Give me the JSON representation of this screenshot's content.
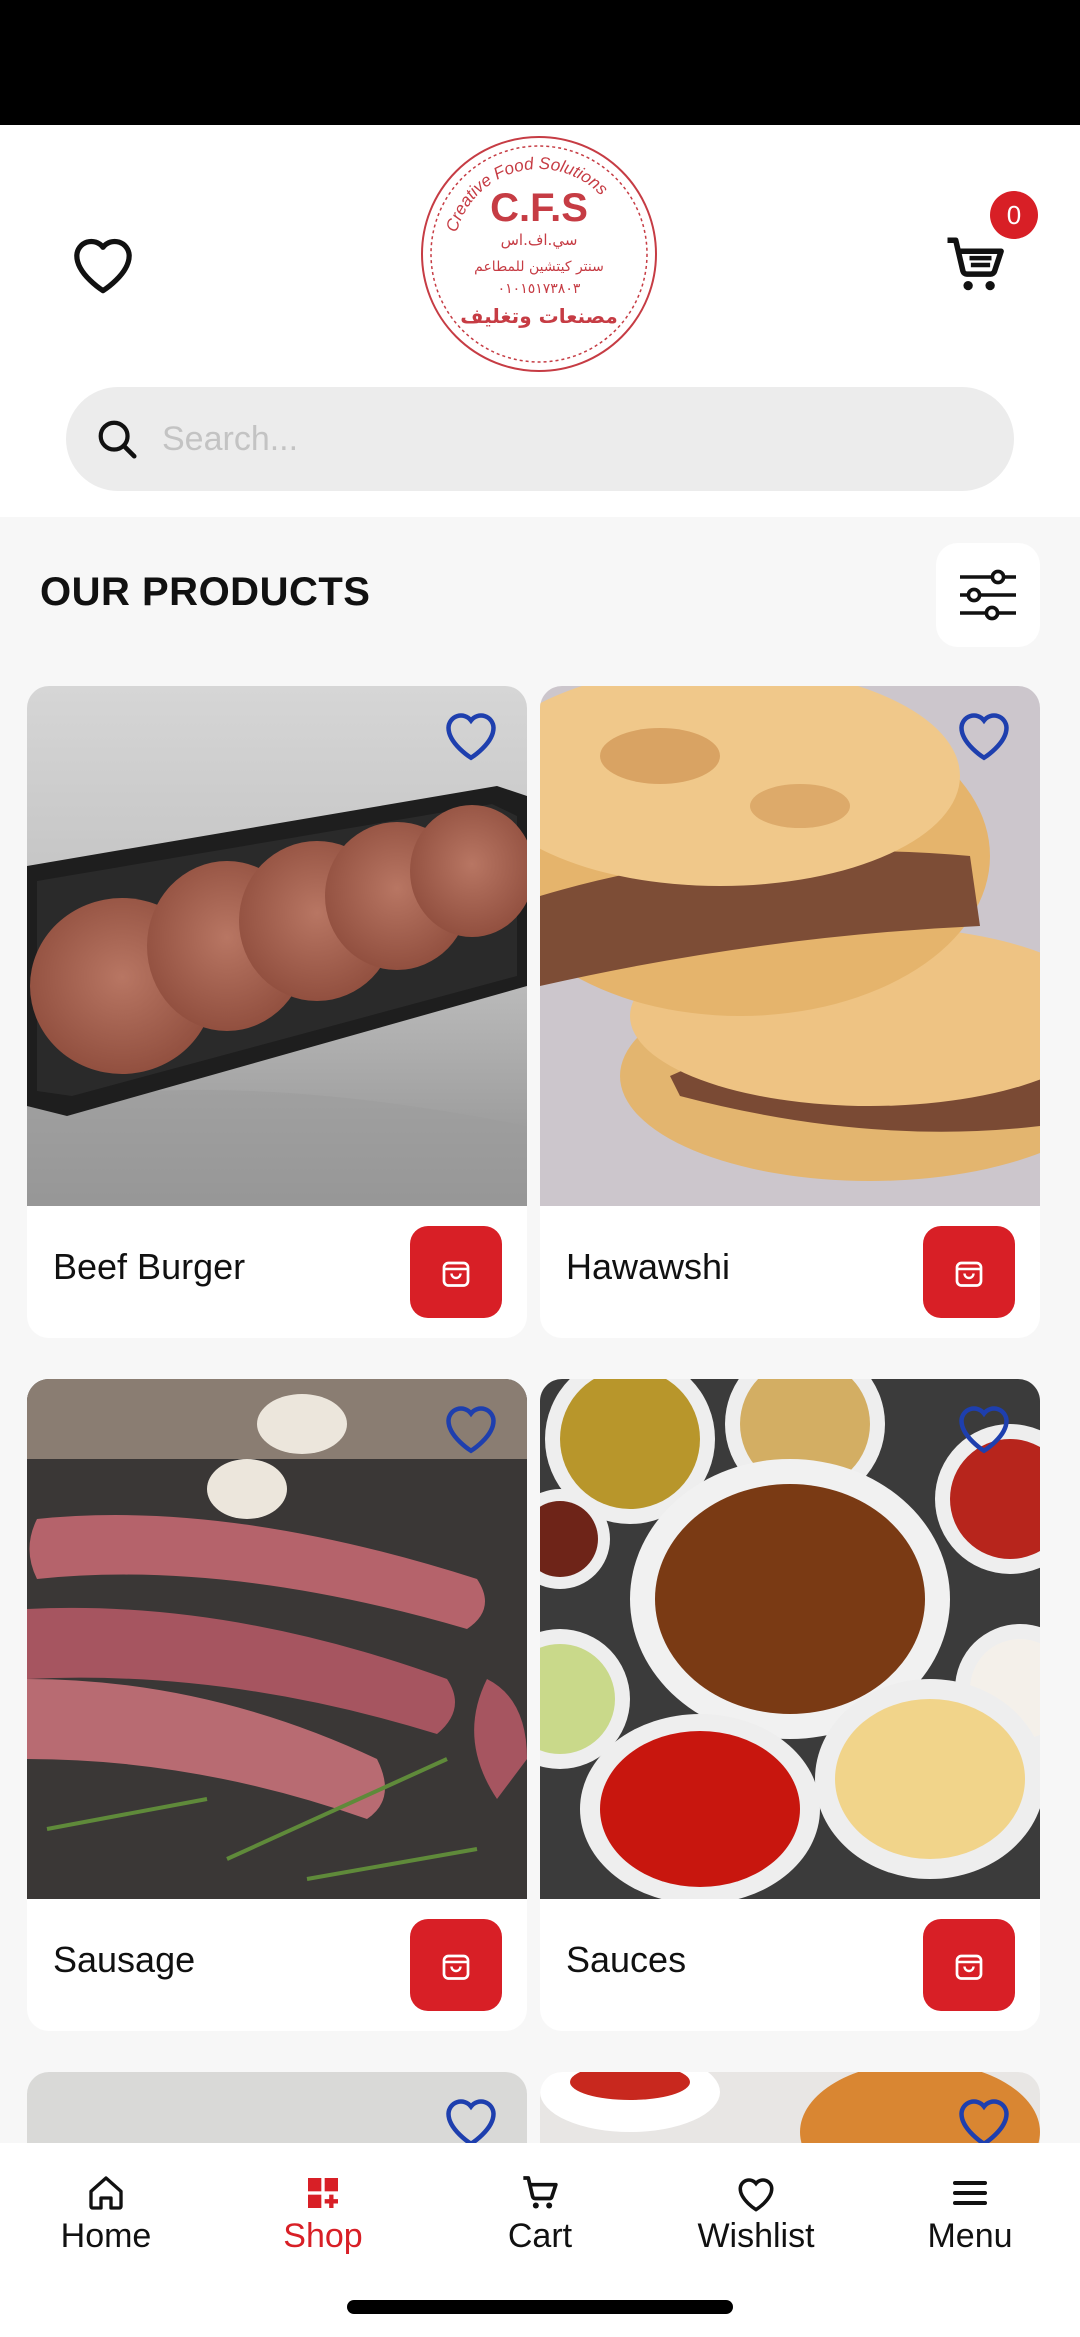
{
  "header": {
    "cart_count": "0",
    "logo_text": {
      "brand": "C.F.S",
      "ring": "Creative Food Solutions",
      "arabic_1": "سي.اف.اس",
      "arabic_2": "سنتر كيتشين للمطاعم",
      "phone": "٠١٠١٥١٧٣٨٠٣",
      "arabic_3": "مصنعات وتغليف"
    }
  },
  "search": {
    "placeholder": "Search..."
  },
  "section": {
    "title": "OUR PRODUCTS"
  },
  "products": [
    {
      "name": "Beef Burger"
    },
    {
      "name": "Hawawshi"
    },
    {
      "name": "Sausage"
    },
    {
      "name": "Sauces"
    }
  ],
  "nav": {
    "home": "Home",
    "shop": "Shop",
    "cart": "Cart",
    "wishlist": "Wishlist",
    "menu": "Menu"
  },
  "colors": {
    "accent": "#d81f26",
    "heart": "#1e3fae"
  }
}
